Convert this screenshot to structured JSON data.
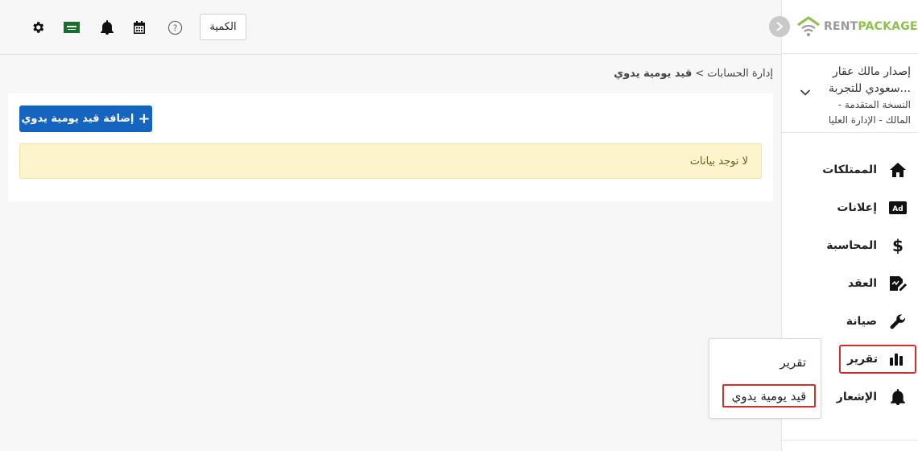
{
  "header": {
    "quantity_label": "الكمية",
    "icons": [
      "gear-icon",
      "saudi-flag-icon",
      "bell-icon",
      "calendar-icon",
      "help-icon"
    ]
  },
  "brand": {
    "logo_part1": "RENT",
    "logo_part2": "PACKAGE",
    "accent_color": "#8bc34a"
  },
  "account": {
    "title": "إصدار مالك عقار سعودي للتجربة...",
    "subtitle": "النسخة المتقدمة - المالك - الإدارة العليا"
  },
  "sidebar": {
    "items": [
      {
        "label": "الممتلكات",
        "icon": "home-icon"
      },
      {
        "label": "إعلانات",
        "icon": "ad-icon"
      },
      {
        "label": "المحاسبة",
        "icon": "dollar-icon"
      },
      {
        "label": "العقد",
        "icon": "contract-icon"
      },
      {
        "label": "صيانة",
        "icon": "wrench-icon"
      },
      {
        "label": "تقرير",
        "icon": "bar-chart-icon"
      },
      {
        "label": "الإشعار",
        "icon": "bell-icon"
      }
    ]
  },
  "submenu": {
    "items": [
      "تقرير",
      "قيد يومية يدوي"
    ]
  },
  "breadcrumb": {
    "parent": "إدارة الحسابات",
    "separator": ">",
    "current": "قيد يومية يدوي"
  },
  "main": {
    "add_button": "إضافة قيد يومية يدوي",
    "empty_message": "لا توجد بيانات",
    "button_color": "#1565c0",
    "highlight_color": "#d32f2f"
  }
}
